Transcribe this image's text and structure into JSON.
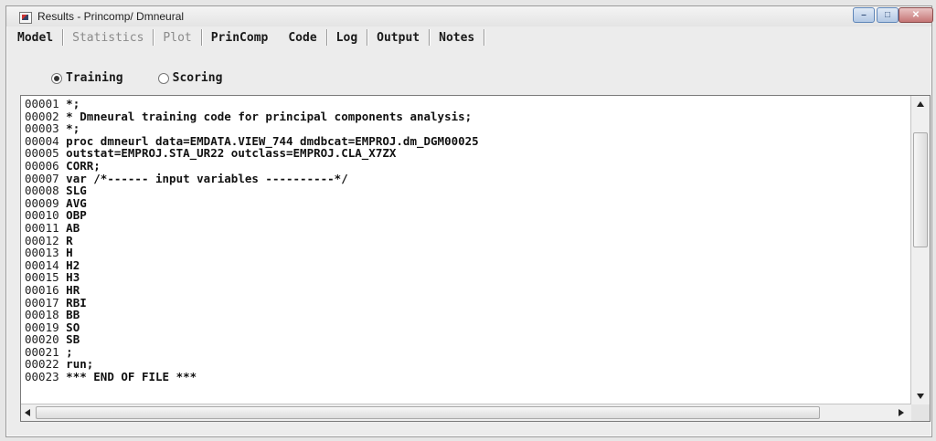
{
  "window": {
    "title": "Results - Princomp/ Dmneural",
    "minimize_glyph": "–",
    "maximize_glyph": "□",
    "close_glyph": "✕"
  },
  "tabs": [
    {
      "label": "Model",
      "enabled": true
    },
    {
      "label": "Statistics",
      "enabled": false
    },
    {
      "label": "Plot",
      "enabled": false
    },
    {
      "label": "PrinComp",
      "enabled": true
    },
    {
      "label": "Code",
      "enabled": true
    },
    {
      "label": "Log",
      "enabled": true
    },
    {
      "label": "Output",
      "enabled": true
    },
    {
      "label": "Notes",
      "enabled": true
    }
  ],
  "mode_options": {
    "training_label": "Training",
    "scoring_label": "Scoring",
    "selected": "Training"
  },
  "code": {
    "lines": [
      {
        "num": "00001",
        "text": "*;"
      },
      {
        "num": "00002",
        "text": "* Dmneural training code for principal components analysis;"
      },
      {
        "num": "00003",
        "text": "*;"
      },
      {
        "num": "00004",
        "text": "proc dmneurl data=EMDATA.VIEW_744 dmdbcat=EMPROJ.dm_DGM00025"
      },
      {
        "num": "00005",
        "text": "outstat=EMPROJ.STA_UR22 outclass=EMPROJ.CLA_X7ZX"
      },
      {
        "num": "00006",
        "text": "CORR;"
      },
      {
        "num": "00007",
        "text": "var /*------ input variables ----------*/"
      },
      {
        "num": "00008",
        "text": "SLG"
      },
      {
        "num": "00009",
        "text": "AVG"
      },
      {
        "num": "00010",
        "text": "OBP"
      },
      {
        "num": "00011",
        "text": "AB"
      },
      {
        "num": "00012",
        "text": "R"
      },
      {
        "num": "00013",
        "text": "H"
      },
      {
        "num": "00014",
        "text": "H2"
      },
      {
        "num": "00015",
        "text": "H3"
      },
      {
        "num": "00016",
        "text": "HR"
      },
      {
        "num": "00017",
        "text": "RBI"
      },
      {
        "num": "00018",
        "text": "BB"
      },
      {
        "num": "00019",
        "text": "SO"
      },
      {
        "num": "00020",
        "text": "SB"
      },
      {
        "num": "00021",
        "text": ";"
      },
      {
        "num": "00022",
        "text": "run;"
      },
      {
        "num": "00023",
        "text": "*** END OF FILE ***"
      }
    ]
  }
}
